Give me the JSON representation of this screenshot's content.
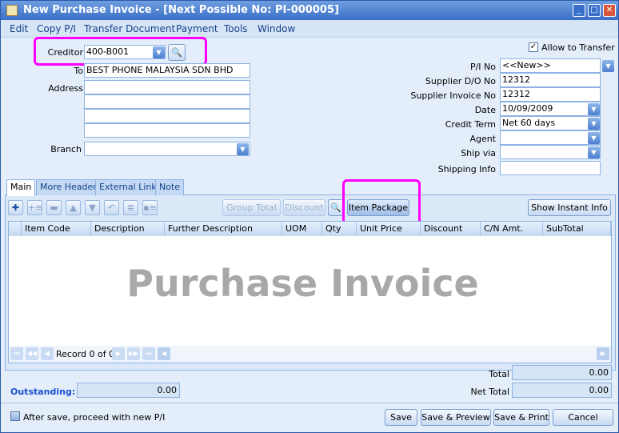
{
  "window": {
    "title": "New Purchase Invoice - [Next Possible No: PI-000005]"
  },
  "menu": [
    "Edit",
    "Copy P/I",
    "Transfer Document",
    "Payment",
    "Tools",
    "Window"
  ],
  "header": {
    "allow_transfer": "Allow to Transfer",
    "creditor_label": "Creditor",
    "creditor": "400-B001",
    "to_label": "To",
    "to": "BEST PHONE MALAYSIA SDN BHD",
    "address_label": "Address",
    "branch_label": "Branch",
    "pi_no_label": "P/I  No",
    "pi_no": "<<New>>",
    "do_label": "Supplier D/O No",
    "do": "12312",
    "inv_label": "Supplier Invoice No",
    "inv": "12312",
    "date_label": "Date",
    "date": "10/09/2009",
    "term_label": "Credit Term",
    "term": "Net 60 days",
    "agent_label": "Agent",
    "shipvia_label": "Ship via",
    "shipinfo_label": "Shipping Info"
  },
  "tabs": [
    "Main",
    "More Header",
    "External Link",
    "Note"
  ],
  "toolbar": {
    "group_total": "Group Total",
    "discount": "Discount",
    "item_package": "Item Package",
    "instant_info": "Show Instant Info"
  },
  "grid": {
    "columns": [
      "Item Code",
      "Description",
      "Further Description",
      "UOM",
      "Qty",
      "Unit Price",
      "Discount",
      "C/N Amt.",
      "SubTotal"
    ],
    "watermark": "Purchase Invoice",
    "record": "Record 0 of 0"
  },
  "totals": {
    "total_label": "Total",
    "total": "0.00",
    "outstanding_label": "Outstanding:",
    "outstanding": "0.00",
    "net_label": "Net Total",
    "net": "0.00"
  },
  "footer": {
    "proceed": "After save, proceed with new P/I",
    "save": "Save",
    "save_preview": "Save & Preview",
    "save_print": "Save & Print",
    "cancel": "Cancel"
  }
}
